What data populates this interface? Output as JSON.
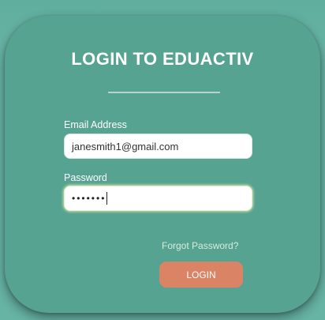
{
  "form": {
    "title": "LOGIN TO EDUACTIV",
    "email_label": "Email Address",
    "email_value": "janesmith1@gmail.com",
    "password_label": "Password",
    "password_masked": "•••••••",
    "forgot_password": "Forgot Password?",
    "login_button": "LOGIN"
  },
  "colors": {
    "background": "#67b3a4",
    "card": "#56a392",
    "button": "#db8365"
  }
}
